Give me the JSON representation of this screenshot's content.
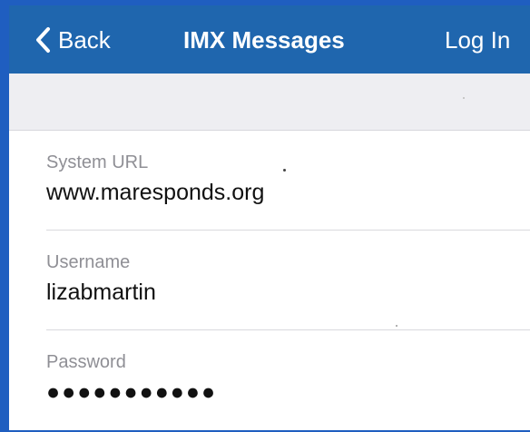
{
  "navbar": {
    "back_label": "Back",
    "title": "IMX Messages",
    "login_label": "Log In",
    "color": "#1f66ae"
  },
  "form": {
    "fields": [
      {
        "label": "System URL",
        "value": "www.maresponds.org"
      },
      {
        "label": "Username",
        "value": "lizabmartin"
      },
      {
        "label": "Password",
        "value": "●●●●●●●●●●●"
      }
    ]
  },
  "colors": {
    "frame": "#1f5ec0",
    "band": "#eeeef2",
    "label_text": "#8f8f95"
  },
  "icons": {
    "back": "chevron-left-icon"
  }
}
